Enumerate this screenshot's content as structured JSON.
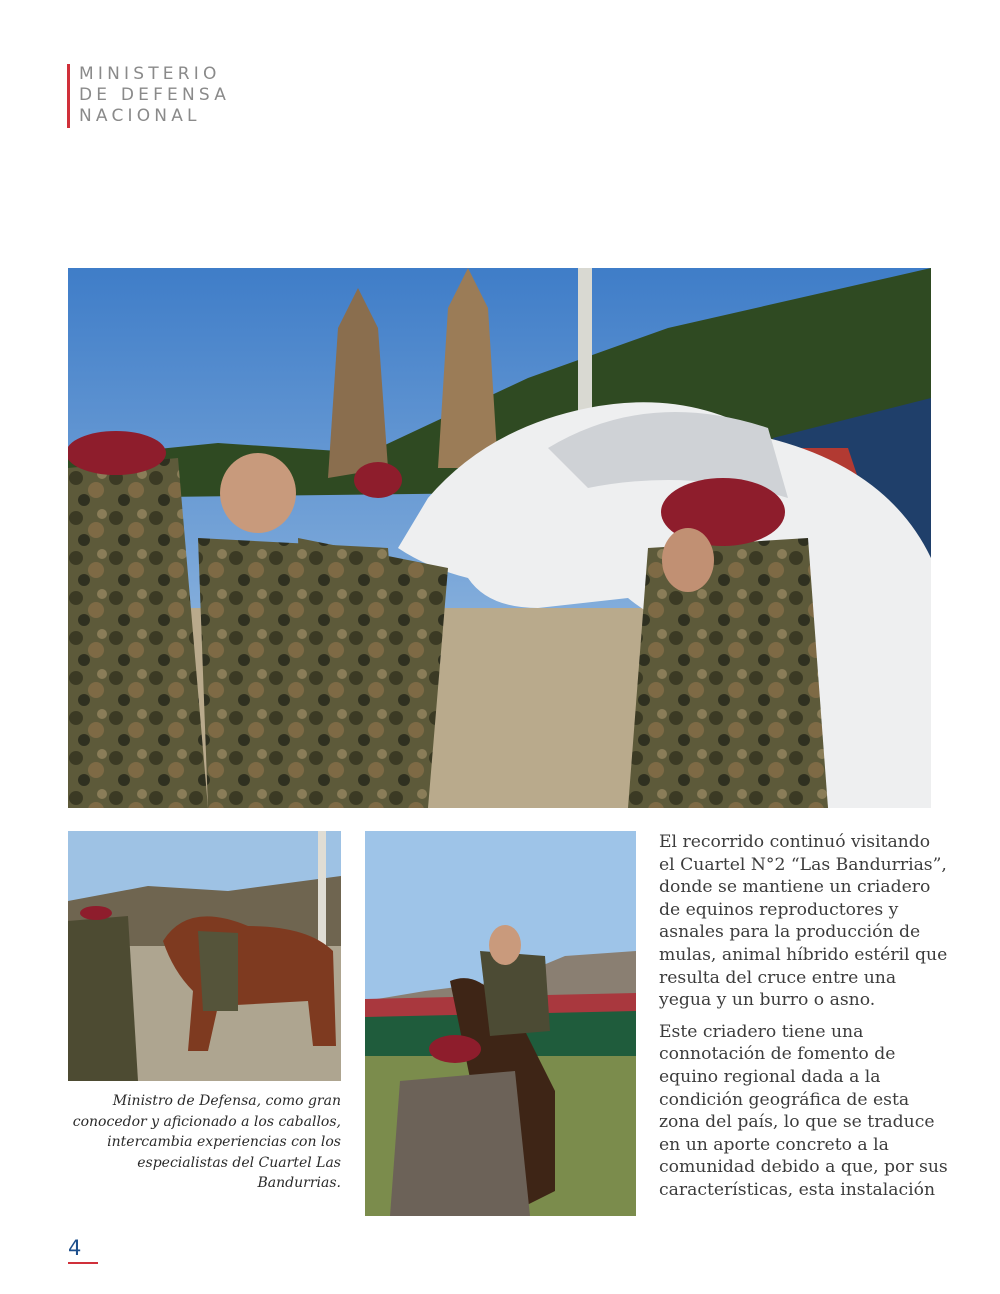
{
  "header": {
    "brand_lines": [
      "MINISTERIO",
      "DE DEFENSA",
      "NACIONAL"
    ]
  },
  "photos": {
    "main": {
      "icon": "photo-soldiers-white-horse"
    },
    "horse": {
      "icon": "photo-brown-horse-soldiers"
    },
    "rider": {
      "icon": "photo-rider-on-horse"
    }
  },
  "caption": "Ministro de Defensa, como gran conocedor y aficionado a los caballos, intercambia experiencias con los especialistas del Cuartel Las Bandurrias.",
  "body": {
    "paragraphs": [
      "El recorrido continuó visitando el Cuartel N°2 “Las Bandurrias”, donde se mantiene un criadero de equinos reproductores y asnales para la producción  de mulas, animal híbrido estéril que resulta del cruce entre una yegua y un burro o asno.",
      "Este criadero tiene una connotación de fomento de equino regional dada a la condición geográfica de esta zona del país, lo que se traduce en un aporte concreto a la comunidad debido a que, por sus características, esta instalación"
    ]
  },
  "page_number": "4",
  "colors": {
    "accent": "#d0303a",
    "page_number": "#1d4f8c",
    "brand_text": "#8a8a8a"
  }
}
